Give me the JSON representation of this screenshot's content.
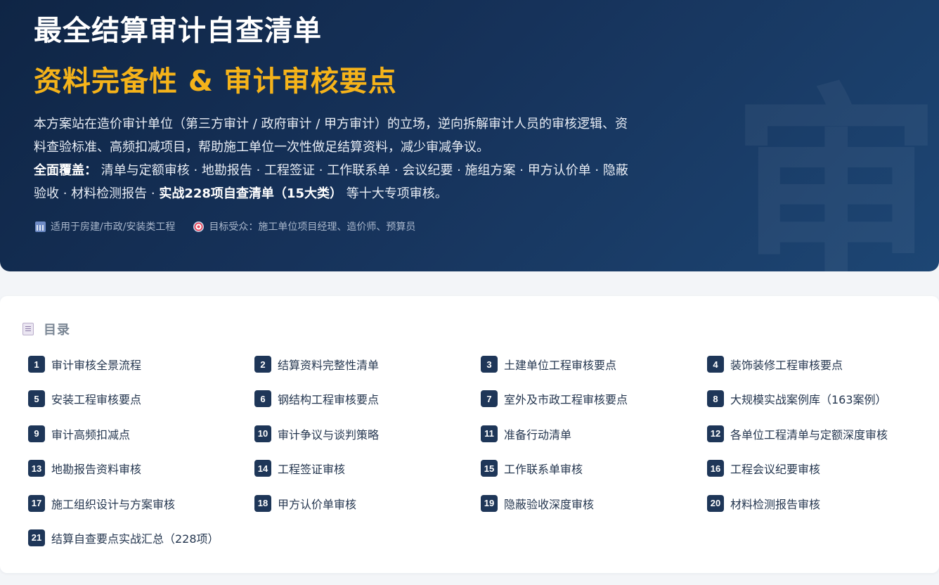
{
  "hero": {
    "title": "最全结算审计自查清单",
    "subtitle": "资料完备性 & 审计审核要点",
    "watermark": "审",
    "desc_p1": "本方案站在造价审计单位（第三方审计 / 政府审计 / 甲方审计）的立场，逆向拆解审计人员的审核逻辑、资料查验标准、高频扣减项目，帮助施工单位一次性做足结算资料，减少审减争议。",
    "desc_coverage_label": "全面覆盖：",
    "desc_coverage_text": " 清单与定额审核 · 地勘报告 · 工程签证 · 工作联系单 · 会议纪要 · 施组方案 · 甲方认价单 · 隐蔽验收 · 材料检测报告 · ",
    "desc_coverage_bold": "实战228项自查清单（15大类）",
    "desc_coverage_tail": " 等十大专项审核。",
    "meta": [
      {
        "icon": "calendar-icon",
        "text": "适用于房建/市政/安装类工程"
      },
      {
        "icon": "target-icon",
        "text": "目标受众：施工单位项目经理、造价师、预算员"
      }
    ]
  },
  "toc": {
    "title": "目录",
    "icon": "document-icon",
    "items": [
      {
        "num": "1",
        "label": "审计审核全景流程"
      },
      {
        "num": "2",
        "label": "结算资料完整性清单"
      },
      {
        "num": "3",
        "label": "土建单位工程审核要点"
      },
      {
        "num": "4",
        "label": "装饰装修工程审核要点"
      },
      {
        "num": "5",
        "label": "安装工程审核要点"
      },
      {
        "num": "6",
        "label": "钢结构工程审核要点"
      },
      {
        "num": "7",
        "label": "室外及市政工程审核要点"
      },
      {
        "num": "8",
        "label": "大规模实战案例库（163案例）"
      },
      {
        "num": "9",
        "label": "审计高频扣减点"
      },
      {
        "num": "10",
        "label": "审计争议与谈判策略"
      },
      {
        "num": "11",
        "label": "准备行动清单"
      },
      {
        "num": "12",
        "label": "各单位工程清单与定额深度审核"
      },
      {
        "num": "13",
        "label": "地勘报告资料审核"
      },
      {
        "num": "14",
        "label": "工程签证审核"
      },
      {
        "num": "15",
        "label": "工作联系单审核"
      },
      {
        "num": "16",
        "label": "工程会议纪要审核"
      },
      {
        "num": "17",
        "label": "施工组织设计与方案审核"
      },
      {
        "num": "18",
        "label": "甲方认价单审核"
      },
      {
        "num": "19",
        "label": "隐蔽验收深度审核"
      },
      {
        "num": "20",
        "label": "材料检测报告审核"
      },
      {
        "num": "21",
        "label": "结算自查要点实战汇总（228项）"
      }
    ]
  }
}
